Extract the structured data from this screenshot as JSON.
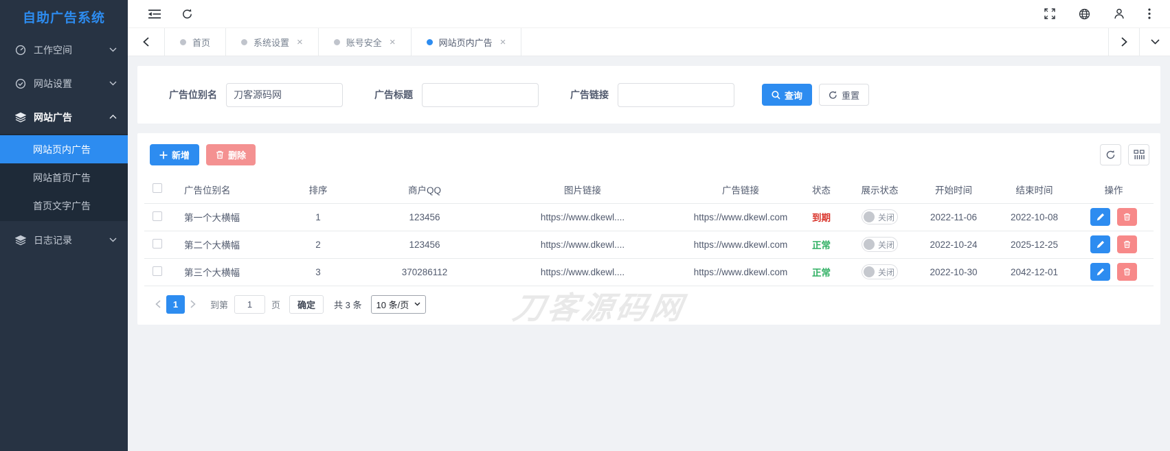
{
  "app": {
    "title": "自助广告系统"
  },
  "sidebar": {
    "items": [
      {
        "label": "工作空间",
        "icon": "gauge-icon"
      },
      {
        "label": "网站设置",
        "icon": "shield-check-icon"
      },
      {
        "label": "网站广告",
        "icon": "layers-icon"
      },
      {
        "label": "日志记录",
        "icon": "layers-icon"
      }
    ],
    "submenu": {
      "parent": "网站广告",
      "items": [
        {
          "label": "网站页内广告",
          "active": true
        },
        {
          "label": "网站首页广告",
          "active": false
        },
        {
          "label": "首页文字广告",
          "active": false
        }
      ]
    }
  },
  "tabbar": {
    "tabs": [
      {
        "label": "首页",
        "closable": false
      },
      {
        "label": "系统设置",
        "closable": true
      },
      {
        "label": "账号安全",
        "closable": true
      },
      {
        "label": "网站页内广告",
        "closable": true
      }
    ],
    "close_glyph": "×"
  },
  "search_form": {
    "fields": [
      {
        "label": "广告位别名",
        "value": "刀客源码网"
      },
      {
        "label": "广告标题",
        "value": ""
      },
      {
        "label": "广告链接",
        "value": ""
      }
    ],
    "search_button": "查询",
    "reset_button": "重置"
  },
  "toolbar": {
    "add_button": "新增",
    "delete_button": "删除"
  },
  "table": {
    "headers": [
      "广告位别名",
      "排序",
      "商户QQ",
      "图片链接",
      "广告链接",
      "状态",
      "展示状态",
      "开始时间",
      "结束时间",
      "操作"
    ],
    "rows": [
      {
        "name": "第一个大横幅",
        "sort": "1",
        "qq": "123456",
        "image_link": "https://www.dkewl....",
        "ad_link": "https://www.dkewl.com",
        "status": "到期",
        "display_state": "关闭",
        "start_time": "2022-11-06",
        "end_time": "2022-10-08"
      },
      {
        "name": "第二个大横幅",
        "sort": "2",
        "qq": "123456",
        "image_link": "https://www.dkewl....",
        "ad_link": "https://www.dkewl.com",
        "status": "正常",
        "display_state": "关闭",
        "start_time": "2022-10-24",
        "end_time": "2025-12-25"
      },
      {
        "name": "第三个大横幅",
        "sort": "3",
        "qq": "370286112",
        "image_link": "https://www.dkewl....",
        "ad_link": "https://www.dkewl.com",
        "status": "正常",
        "display_state": "关闭",
        "start_time": "2022-10-30",
        "end_time": "2042-12-01"
      }
    ]
  },
  "pagination": {
    "current_page": "1",
    "goto_label": "到第",
    "goto_value": "1",
    "page_unit": "页",
    "confirm_button": "确定",
    "total_text": "共 3 条",
    "page_size": "10 条/页"
  },
  "watermark": "刀客源码网",
  "colors": {
    "primary": "#2d8cf0",
    "danger_soft": "#f49191",
    "status_expired": "#d9342b",
    "status_normal": "#2eaf62",
    "sidebar_bg": "#273343",
    "sidebar_submenu_bg": "#1e2a38",
    "content_bg": "#f0f2f5"
  }
}
